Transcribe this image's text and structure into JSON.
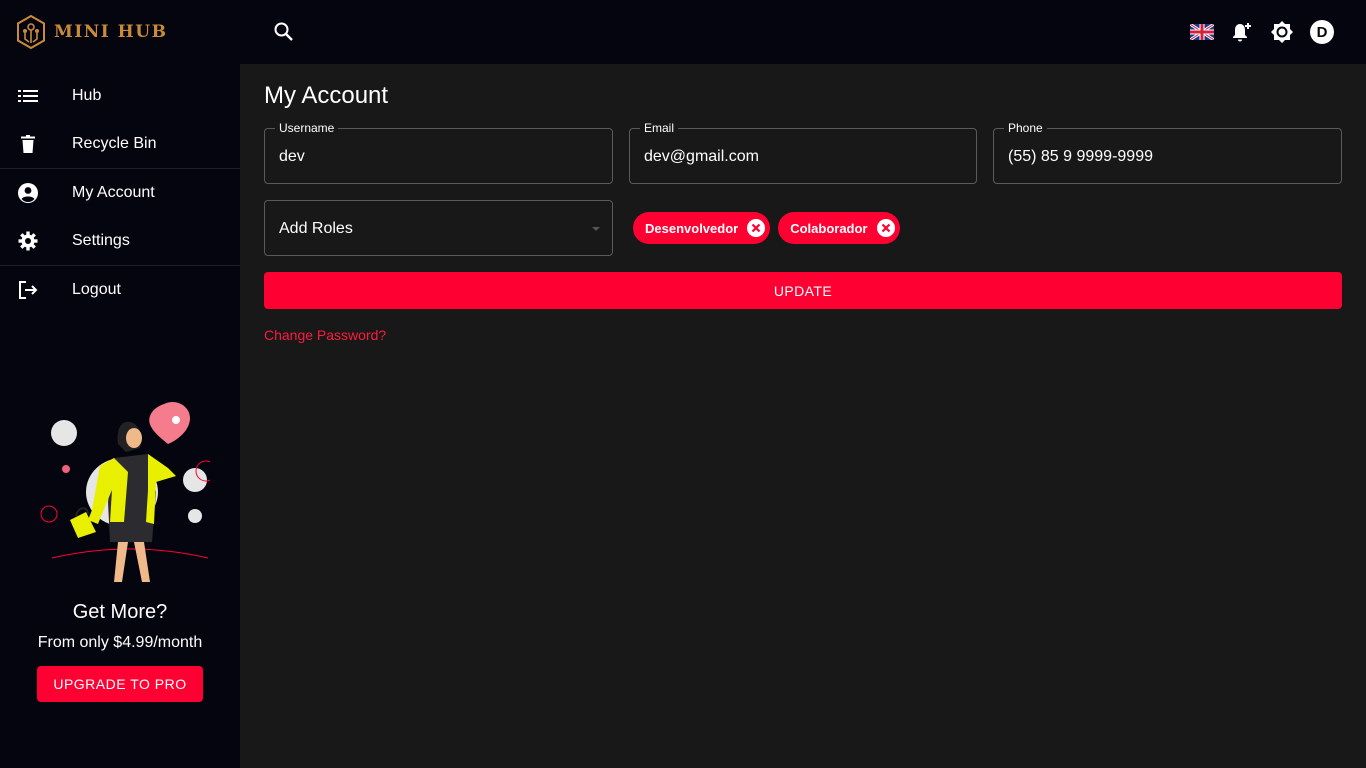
{
  "app": {
    "name": "MINI HUB"
  },
  "sidebar": {
    "items": [
      {
        "label": "Hub",
        "icon": "list-icon"
      },
      {
        "label": "Recycle Bin",
        "icon": "trash-icon"
      },
      {
        "label": "My Account",
        "icon": "account-circle-icon"
      },
      {
        "label": "Settings",
        "icon": "gear-icon"
      },
      {
        "label": "Logout",
        "icon": "logout-icon"
      }
    ],
    "promo": {
      "title": "Get More?",
      "subtitle": "From only $4.99/month",
      "button": "UPGRADE TO PRO"
    }
  },
  "topbar": {
    "language": "en-GB",
    "avatar_initial": "D"
  },
  "page": {
    "title": "My Account",
    "fields": {
      "username": {
        "label": "Username",
        "value": "dev"
      },
      "email": {
        "label": "Email",
        "value": "dev@gmail.com"
      },
      "phone": {
        "label": "Phone",
        "value": "(55) 85 9 9999-9999"
      }
    },
    "roles_select": {
      "placeholder": "Add Roles"
    },
    "roles": [
      "Desenvolvedor",
      "Colaborador"
    ],
    "update_button": "UPDATE",
    "change_password": "Change Password?"
  },
  "colors": {
    "accent": "#ff0033",
    "sidebar_bg": "#050510",
    "main_bg": "#181818",
    "logo": "#c98a3a"
  }
}
